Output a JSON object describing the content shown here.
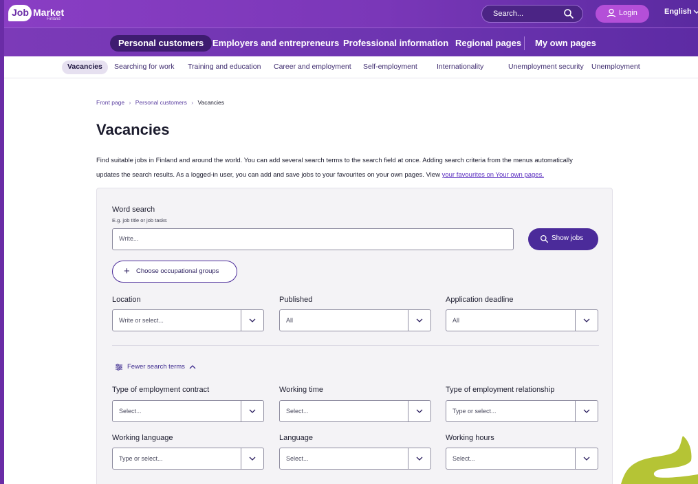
{
  "header": {
    "logo": {
      "job": "Job",
      "market": "Market",
      "country": "Finland"
    },
    "search_label": "Search...",
    "login_label": "Login",
    "language": "English"
  },
  "main_nav": [
    {
      "label": "Personal customers",
      "active": true
    },
    {
      "label": "Employers and entrepreneurs",
      "active": false
    },
    {
      "label": "Professional information",
      "active": false
    },
    {
      "label": "Regional pages",
      "active": false
    },
    {
      "label": "My own pages",
      "active": false
    }
  ],
  "sub_nav": [
    {
      "label": "Vacancies",
      "active": true
    },
    {
      "label": "Searching for work",
      "active": false
    },
    {
      "label": "Training and education",
      "active": false
    },
    {
      "label": "Career and employment",
      "active": false
    },
    {
      "label": "Self-employment",
      "active": false
    },
    {
      "label": "Internationality",
      "active": false
    },
    {
      "label": "Unemployment security",
      "active": false
    },
    {
      "label": "Unemployment",
      "active": false
    }
  ],
  "breadcrumb": [
    "Front page",
    "Personal customers",
    "Vacancies"
  ],
  "page": {
    "title": "Vacancies",
    "intro_line1": "Find suitable jobs in Finland and around the world. You can add several search terms to the search field at once. Adding search criteria from the menus automatically",
    "intro_line2": "updates the search results. As a logged-in user, you can add and save jobs to your favourites on your own pages. View ",
    "intro_link": "your favourites on Your own pages."
  },
  "search": {
    "word_search_label": "Word search",
    "word_search_hint": "E.g. job title or job tasks",
    "word_search_placeholder": "Write...",
    "show_jobs_label": "Show jobs",
    "occupational_groups_label": "Choose occupational groups",
    "location": {
      "label": "Location",
      "value": "Write or select..."
    },
    "published": {
      "label": "Published",
      "value": "All"
    },
    "application_deadline": {
      "label": "Application deadline",
      "value": "All"
    },
    "fewer_terms_label": "Fewer search terms",
    "contract_type": {
      "label": "Type of employment contract",
      "value": "Select..."
    },
    "working_time": {
      "label": "Working time",
      "value": "Select..."
    },
    "relationship_type": {
      "label": "Type of employment relationship",
      "value": "Type or select..."
    },
    "working_language": {
      "label": "Working language",
      "value": "Type or select..."
    },
    "language": {
      "label": "Language",
      "value": "Select..."
    },
    "working_hours": {
      "label": "Working hours",
      "value": "Select..."
    }
  },
  "colors": {
    "brand_purple": "#7a37b8",
    "button_purple": "#4b2b9a",
    "accent_green": "#b5c435"
  }
}
